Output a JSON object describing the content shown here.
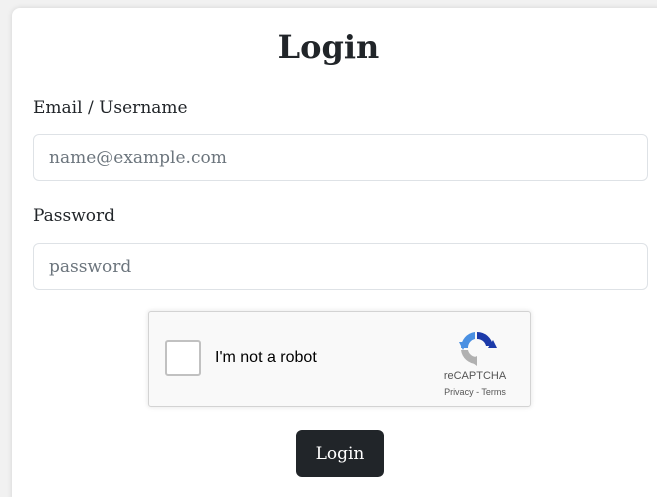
{
  "form": {
    "title": "Login",
    "email_label": "Email / Username",
    "email_placeholder": "name@example.com",
    "password_label": "Password",
    "password_placeholder": "password",
    "submit_label": "Login"
  },
  "recaptcha": {
    "checkbox_label": "I'm not a robot",
    "brand": "reCAPTCHA",
    "privacy_link": "Privacy",
    "separator": " - ",
    "terms_link": "Terms",
    "checked": false
  },
  "colors": {
    "primary_button": "#212529",
    "recaptcha_blue": "#1c3aa9",
    "recaptcha_light_blue": "#4a90e2",
    "recaptcha_gray": "#b1b1b1"
  }
}
